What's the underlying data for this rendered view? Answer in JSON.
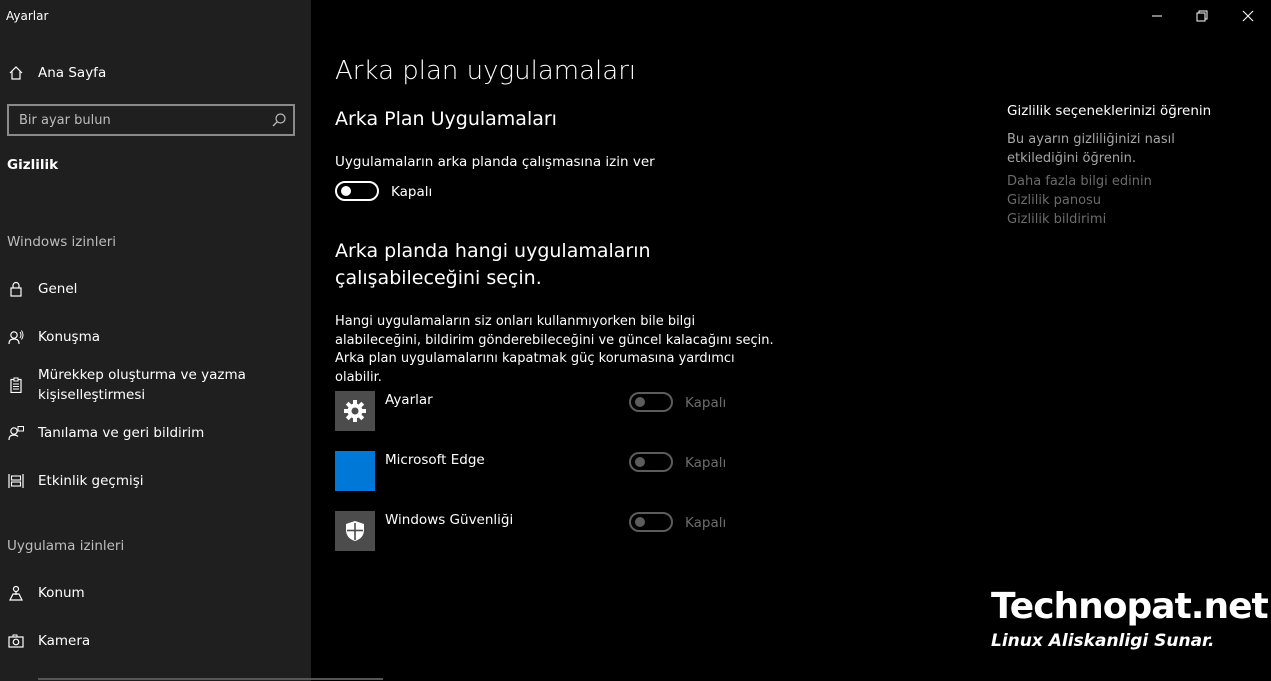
{
  "window": {
    "title": "Ayarlar"
  },
  "sidebar": {
    "home_label": "Ana Sayfa",
    "search_placeholder": "Bir ayar bulun",
    "section": "Gizlilik",
    "group_windows": "Windows izinleri",
    "group_apps": "Uygulama izinleri",
    "items": [
      {
        "label": "Genel",
        "icon": "lock-icon"
      },
      {
        "label": "Konuşma",
        "icon": "speech-icon"
      },
      {
        "label": "Mürekkep oluşturma ve yazma kişiselleştirmesi",
        "icon": "clipboard-icon"
      },
      {
        "label": "Tanılama ve geri bildirim",
        "icon": "feedback-icon"
      },
      {
        "label": "Etkinlik geçmişi",
        "icon": "timeline-icon"
      },
      {
        "label": "Konum",
        "icon": "location-icon"
      },
      {
        "label": "Kamera",
        "icon": "camera-icon"
      }
    ]
  },
  "main": {
    "page_title": "Arka plan uygulamaları",
    "section_title": "Arka Plan Uygulamaları",
    "allow_label": "Uygulamaların arka planda çalışmasına izin ver",
    "allow_state": "Kapalı",
    "choose_title": "Arka planda hangi uygulamaların çalışabileceğini seçin.",
    "choose_desc": "Hangi uygulamaların siz onları kullanmıyorken bile bilgi alabileceğini, bildirim gönderebileceğini ve güncel kalacağını seçin. Arka plan uygulamalarını kapatmak güç korumasına yardımcı olabilir.",
    "apps": [
      {
        "name": "Ayarlar",
        "state": "Kapalı",
        "icon": "gear-icon",
        "tile_color": "#4c4c4c"
      },
      {
        "name": "Microsoft Edge",
        "state": "Kapalı",
        "icon": "edge-icon",
        "tile_color": "#0078d7"
      },
      {
        "name": "Windows Güvenliği",
        "state": "Kapalı",
        "icon": "shield-icon",
        "tile_color": "#4c4c4c"
      }
    ]
  },
  "right_panel": {
    "title": "Gizlilik seçeneklerinizi öğrenin",
    "desc": "Bu ayarın gizliliğinizi nasıl etkilediğini öğrenin.",
    "links": [
      "Daha fazla bilgi edinin",
      "Gizlilik panosu",
      "Gizlilik bildirimi"
    ]
  },
  "watermark": {
    "brand": "Technopat.net",
    "tagline": "Linux Aliskanligi Sunar."
  }
}
